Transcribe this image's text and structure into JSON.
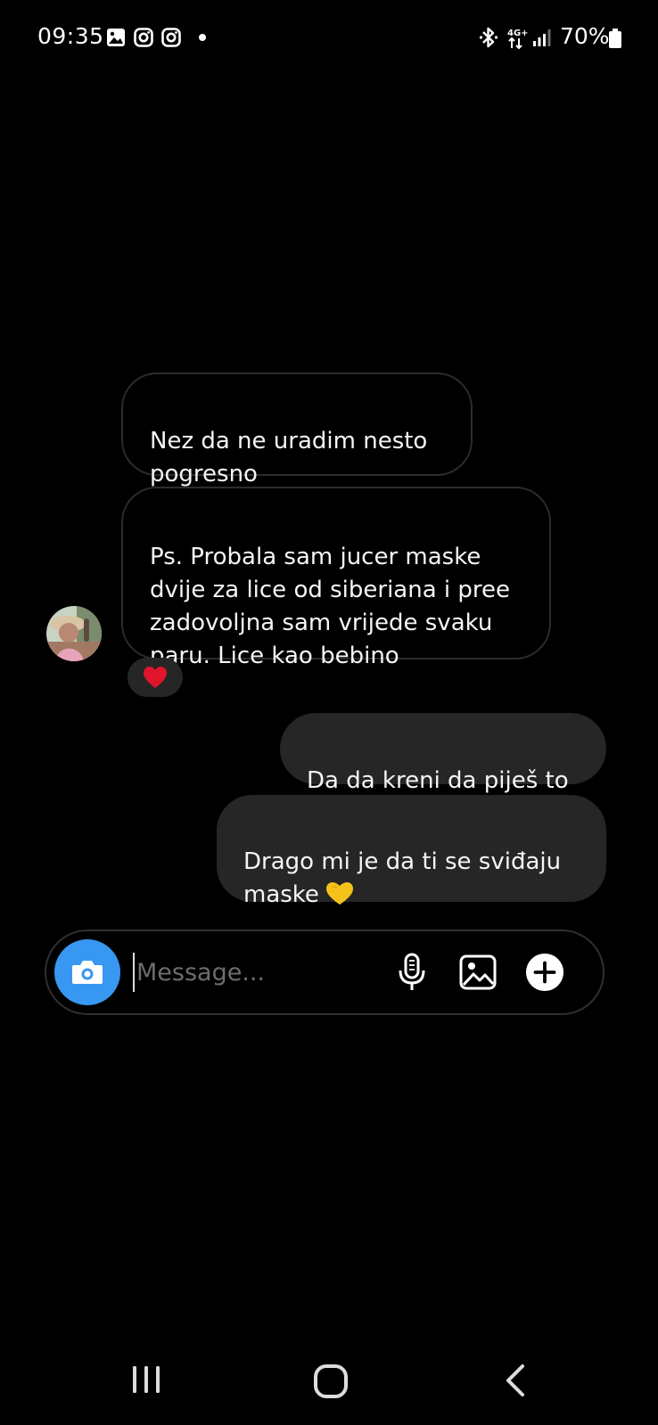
{
  "status_bar": {
    "time": "09:35",
    "left_icons": [
      "gallery-notification-icon",
      "instagram-icon",
      "instagram-icon"
    ],
    "right_icons": [
      "bluetooth-icon",
      "4g-plus-icon",
      "signal-icon",
      "battery-icon"
    ],
    "network_label": "4G+",
    "battery": "70%"
  },
  "chat": {
    "messages": [
      {
        "direction": "incoming",
        "text": "Nez da ne uradim nesto\npogresno"
      },
      {
        "direction": "incoming",
        "text": "Ps. Probala sam jucer maske\ndvije za lice od siberiana i pree\nzadovoljna sam vrijede svaku\nparu. Lice kao bebino"
      },
      {
        "direction": "outgoing",
        "text": "Da da kreni da piješ to"
      },
      {
        "direction": "outgoing",
        "text": "Drago mi je da ti se sviđaju\nmaske",
        "emoji": "💛"
      }
    ],
    "reaction": "❤️"
  },
  "composer": {
    "placeholder": "Message..."
  },
  "colors": {
    "background": "#000000",
    "outgoing_bubble": "#262626",
    "incoming_border": "#2c2c2c",
    "camera_button": "#3897f0",
    "heart_reaction": "#e0142b"
  }
}
